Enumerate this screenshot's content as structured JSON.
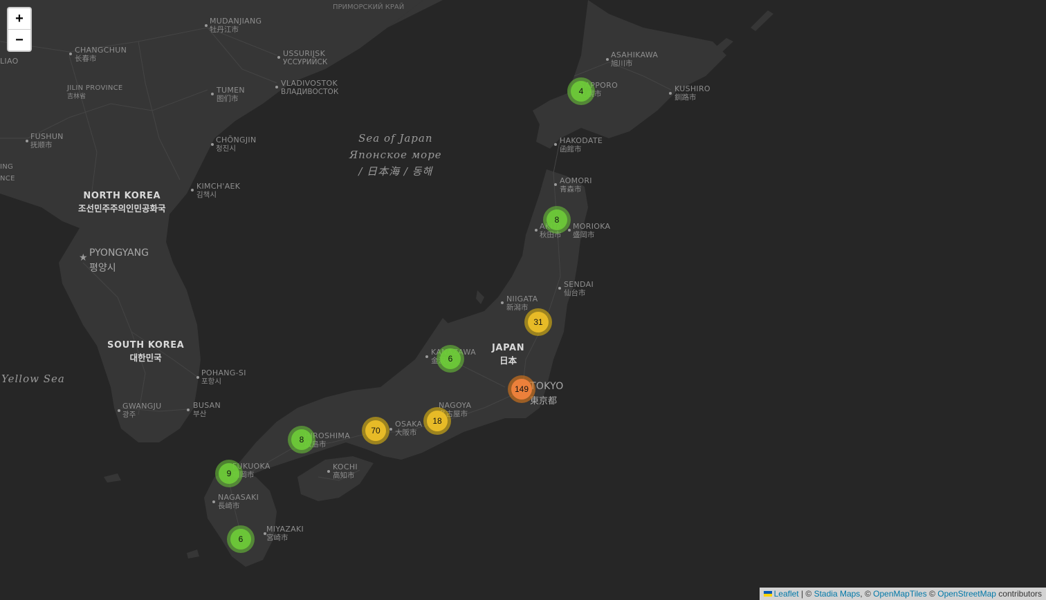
{
  "zoom": {
    "in_label": "+",
    "out_label": "−"
  },
  "attribution": {
    "leaflet": "Leaflet",
    "sep1": " | © ",
    "stadia": "Stadia Maps",
    "sep2": ", © ",
    "openmaptiles": "OpenMapTiles",
    "sep3": " © ",
    "osm": "OpenStreetMap",
    "suffix": " contributors"
  },
  "seas": {
    "sea_of_japan": [
      "Sea of Japan",
      "Японское море",
      "/ 日本海 / 동해"
    ],
    "yellow_sea": "Yellow Sea",
    "primorsky": "ПРИМОРСКИЙ КРАЙ"
  },
  "countries": {
    "north_korea": {
      "name": "NORTH KOREA",
      "local": "조선민주주의인민공화국"
    },
    "south_korea": {
      "name": "SOUTH KOREA",
      "local": "대한민국"
    },
    "japan": {
      "name": "JAPAN",
      "local": "日本"
    }
  },
  "capital": {
    "name": "PYONGYANG",
    "local": "평양시"
  },
  "cities": {
    "mudanjiang": {
      "name": "MUDANJIANG",
      "local": "牡丹江市"
    },
    "changchun": {
      "name": "CHANGCHUN",
      "local": "长春市"
    },
    "liao": {
      "name": "LIAO",
      "local": ""
    },
    "jilin": {
      "name": "JILIN PROVINCE",
      "local": "吉林省"
    },
    "ussuriysk": {
      "name": "USSURIJSK",
      "local": "УССУРИЙСК"
    },
    "vladivostok": {
      "name": "VLADIVOSTOK",
      "local": "ВЛАДИВОСТОК"
    },
    "tumen": {
      "name": "TUMEN",
      "local": "图们市"
    },
    "fushun": {
      "name": "FUSHUN",
      "local": "抚顺市"
    },
    "chongjin": {
      "name": "CHŎNGJIN",
      "local": "청진시"
    },
    "kimchaek": {
      "name": "KIMCH'AEK",
      "local": "김책시"
    },
    "ing": {
      "name": "ING",
      "local": "NCE"
    },
    "asahikawa": {
      "name": "ASAHIKAWA",
      "local": "旭川市"
    },
    "sapporo": {
      "name": "SAPPORO",
      "local": "札幌市"
    },
    "kushiro": {
      "name": "KUSHIRO",
      "local": "釧路市"
    },
    "hakodate": {
      "name": "HAKODATE",
      "local": "函館市"
    },
    "aomori": {
      "name": "AOMORI",
      "local": "青森市"
    },
    "akita": {
      "name": "AKITA",
      "local": "秋田市"
    },
    "morioka": {
      "name": "MORIOKA",
      "local": "盛岡市"
    },
    "sendai": {
      "name": "SENDAI",
      "local": "仙台市"
    },
    "niigata": {
      "name": "NIIGATA",
      "local": "新潟市"
    },
    "kanazawa": {
      "name": "KANAZAWA",
      "local": "金沢市"
    },
    "tokyo": {
      "name": "TOKYO",
      "local": "東京都"
    },
    "nagoya": {
      "name": "NAGOYA",
      "local": "名古屋市"
    },
    "osaka": {
      "name": "OSAKA",
      "local": "大阪市"
    },
    "hiroshima": {
      "name": "HIROSHIMA",
      "local": "広島市"
    },
    "kochi": {
      "name": "KOCHI",
      "local": "高知市"
    },
    "fukuoka": {
      "name": "FUKUOKA",
      "local": "福岡市"
    },
    "nagasaki": {
      "name": "NAGASAKI",
      "local": "長崎市"
    },
    "miyazaki": {
      "name": "MIYAZAKI",
      "local": "宮崎市"
    },
    "pohang": {
      "name": "POHANG-SI",
      "local": "포항시"
    },
    "gwangju": {
      "name": "GWANGJU",
      "local": "광주"
    },
    "busan": {
      "name": "BUSAN",
      "local": "부산"
    }
  },
  "clusters": [
    {
      "id": "sapporo",
      "count": "4",
      "level": "green"
    },
    {
      "id": "akita",
      "count": "8",
      "level": "green"
    },
    {
      "id": "sendai",
      "count": "31",
      "level": "yellow"
    },
    {
      "id": "kanazawa",
      "count": "6",
      "level": "green"
    },
    {
      "id": "tokyo",
      "count": "149",
      "level": "orange"
    },
    {
      "id": "nagoya",
      "count": "18",
      "level": "yellow"
    },
    {
      "id": "osaka",
      "count": "70",
      "level": "yellow"
    },
    {
      "id": "hiroshima",
      "count": "8",
      "level": "green"
    },
    {
      "id": "fukuoka",
      "count": "9",
      "level": "green"
    },
    {
      "id": "miyazaki",
      "count": "6",
      "level": "green"
    }
  ],
  "colors": {
    "background": "#262626",
    "land": "#363636",
    "cluster_green": "#6ecc39",
    "cluster_yellow": "#f0c20c",
    "cluster_orange": "#f18017"
  }
}
